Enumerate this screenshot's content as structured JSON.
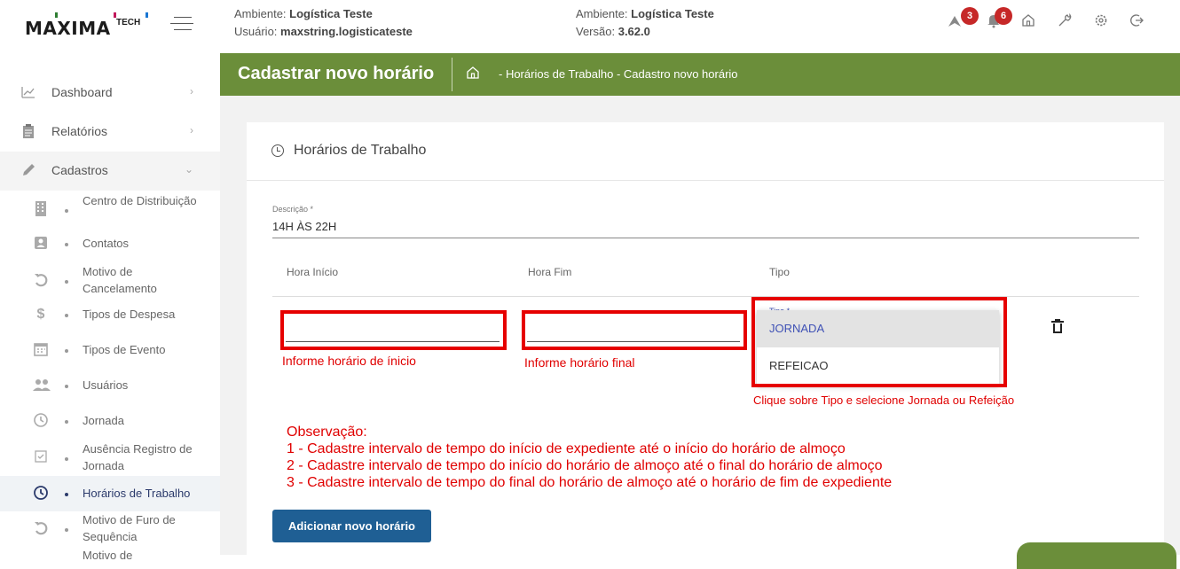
{
  "header": {
    "brand": "MAXIMA",
    "brand_suffix": "TECH",
    "env1_label": "Ambiente:",
    "env1_value": "Logística Teste",
    "user_label": "Usuário:",
    "user_value": "maxstring.logisticateste",
    "env2_label": "Ambiente:",
    "env2_value": "Logística Teste",
    "version_label": "Versão:",
    "version_value": "3.62.0",
    "badge_routes": "3",
    "badge_notifications": "6",
    "icons": [
      "route-icon",
      "bell-icon",
      "home-icon",
      "wrench-icon",
      "gear-icon",
      "logout-icon"
    ]
  },
  "sidebar": {
    "main_items": [
      {
        "label": "Dashboard",
        "icon": "chart-icon"
      },
      {
        "label": "Relatórios",
        "icon": "clipboard-icon"
      },
      {
        "label": "Cadastros",
        "icon": "pencil-icon"
      }
    ],
    "sub_items": [
      {
        "label": "Centro de Distribuição",
        "icon": "building-icon"
      },
      {
        "label": "Contatos",
        "icon": "contact-icon"
      },
      {
        "label": "Motivo de Cancelamento",
        "icon": "undo-icon"
      },
      {
        "label": "Tipos de Despesa",
        "icon": "dollar-icon"
      },
      {
        "label": "Tipos de Evento",
        "icon": "calendar-icon"
      },
      {
        "label": "Usuários",
        "icon": "users-icon"
      },
      {
        "label": "Jornada",
        "icon": "clock-icon"
      },
      {
        "label": "Ausência Registro de Jornada",
        "icon": "checkbox-icon"
      },
      {
        "label": "Horários de Trabalho",
        "icon": "clock-icon"
      },
      {
        "label": "Motivo de Furo de Sequência",
        "icon": "undo-icon"
      },
      {
        "label": "Motivo de",
        "icon": "undo-icon"
      }
    ]
  },
  "page": {
    "title": "Cadastrar novo horário",
    "breadcrumb": "- Horários de Trabalho - Cadastro novo horário"
  },
  "card": {
    "title": "Horários de Trabalho",
    "description_label": "Descrição *",
    "description_value": "14H ÀS 22H",
    "col_start": "Hora Início",
    "col_end": "Hora Fim",
    "col_type": "Tipo",
    "type_field_label": "Tipo *",
    "type_options": [
      "JORNADA",
      "REFEICAO"
    ],
    "hint_start": "Informe horário de ínicio",
    "hint_end": "Informe horário final",
    "hint_type": "Clique sobre Tipo e selecione Jornada ou Refeição",
    "observation_title": "Observação:",
    "observation_lines": [
      "1 - Cadastre intervalo de tempo do início de expediente até o início do horário de almoço",
      "2 - Cadastre intervalo de tempo do início do horário de almoço até o final do horário de almoço",
      "3 - Cadastre intervalo de tempo do final do horário de almoço até o horário de fim de expediente"
    ],
    "add_button": "Adicionar novo horário"
  },
  "colors": {
    "green": "#6b8e3a",
    "button_blue": "#1f5f94",
    "annotation_red": "#e00000",
    "badge_red": "#c62828"
  }
}
